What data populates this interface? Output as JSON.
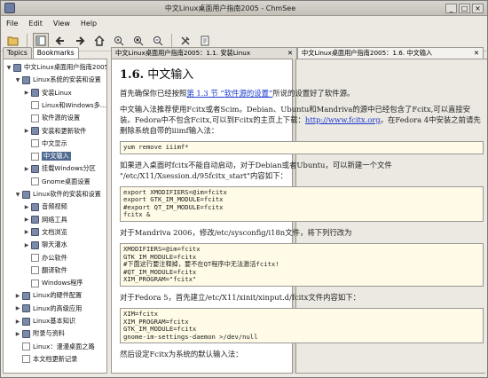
{
  "window": {
    "title": "中文Linux桌面用户指南2005 - ChmSee"
  },
  "menubar": {
    "file": "File",
    "edit": "Edit",
    "view": "View",
    "help": "Help"
  },
  "toolbar": {
    "icons": [
      "folder-open-icon",
      "sidebar-toggle-icon",
      "back-icon",
      "forward-icon",
      "home-icon",
      "zoom-in-icon",
      "zoom-reset-icon",
      "zoom-out-icon",
      "settings-icon",
      "info-icon"
    ]
  },
  "sidebar": {
    "tabs": [
      {
        "label": "Topics"
      },
      {
        "label": "Bookmarks"
      }
    ],
    "items": [
      {
        "label": "中文Linux桌面用户指南2005",
        "level": 0,
        "expander": "▼",
        "icon": "book"
      },
      {
        "label": "Linux系统的安装和设置",
        "level": 1,
        "expander": "▼",
        "icon": "book"
      },
      {
        "label": "安装Linux",
        "level": 2,
        "expander": "▶",
        "icon": "book"
      },
      {
        "label": "Linux和Windows多...",
        "level": 2,
        "expander": "",
        "icon": "page"
      },
      {
        "label": "软件源的设置",
        "level": 2,
        "expander": "",
        "icon": "page"
      },
      {
        "label": "安装和更新软件",
        "level": 2,
        "expander": "▶",
        "icon": "book"
      },
      {
        "label": "中文显示",
        "level": 2,
        "expander": "",
        "icon": "page"
      },
      {
        "label": "中文输入",
        "level": 2,
        "expander": "",
        "icon": "page",
        "selected": true
      },
      {
        "label": "挂载Windows分区",
        "level": 2,
        "expander": "▶",
        "icon": "book"
      },
      {
        "label": "Gnome桌面设置",
        "level": 2,
        "expander": "",
        "icon": "page"
      },
      {
        "label": "Linux软件的安装和设置",
        "level": 1,
        "expander": "▼",
        "icon": "book"
      },
      {
        "label": "音频视频",
        "level": 2,
        "expander": "▶",
        "icon": "book"
      },
      {
        "label": "网络工具",
        "level": 2,
        "expander": "▶",
        "icon": "book"
      },
      {
        "label": "文档浏览",
        "level": 2,
        "expander": "▶",
        "icon": "book"
      },
      {
        "label": "聊天灌水",
        "level": 2,
        "expander": "▶",
        "icon": "book"
      },
      {
        "label": "办公软件",
        "level": 2,
        "expander": "",
        "icon": "page"
      },
      {
        "label": "翻译软件",
        "level": 2,
        "expander": "",
        "icon": "page"
      },
      {
        "label": "Windows程序",
        "level": 2,
        "expander": "",
        "icon": "page"
      },
      {
        "label": "Linux的硬件配置",
        "level": 1,
        "expander": "▶",
        "icon": "book"
      },
      {
        "label": "Linux的高级应用",
        "level": 1,
        "expander": "▶",
        "icon": "book"
      },
      {
        "label": "Linux基本知识",
        "level": 1,
        "expander": "▶",
        "icon": "book"
      },
      {
        "label": "附录与资料",
        "level": 1,
        "expander": "▶",
        "icon": "book"
      },
      {
        "label": "Linux：漫漫桌面之路",
        "level": 1,
        "expander": "",
        "icon": "page"
      },
      {
        "label": "本文档更新记录",
        "level": 1,
        "expander": "",
        "icon": "page"
      }
    ]
  },
  "tabs": [
    {
      "label": "中文Linux桌面用户指南2005：1.1. 安装Linux",
      "close": "✕"
    },
    {
      "label": "中文Linux桌面用户指南2005：1.6. 中文输入",
      "close": "✕"
    }
  ],
  "page": {
    "heading_num": "1.6.",
    "heading_text": "中文输入",
    "p1_a": "首先确保你已经按照",
    "p1_link": "第 1.3 节 “软件源的设置”",
    "p1_b": "所说的设置好了软件源。",
    "p2_a": "中文输入法推荐使用Fcitx或者Scim。Debian、Ubuntu和Mandriva的源中已经包含了Fcitx,可以直接安装。Fedora中不包含Fcitx,可以到Fcitx的主页上下载：",
    "p2_link": "http://www.fcitx.org",
    "p2_b": "。在Fedora 4中安装之前请先删除系统自带的iiimf输入法：",
    "code1": "yum remove iiimf*",
    "p3": "如果进入桌面时fcitx不能自动启动，对于Debian或者Ubuntu，可以新建一个文件 \"/etc/X11/Xsession.d/95fcitx_start\"内容如下：",
    "code2": "export XMODIFIERS=@im=fcitx\nexport GTK_IM_MODULE=fcitx\n#export QT_IM_MODULE=fcitx\nfcitx &",
    "p4": "对于Mandriva 2006，修改/etc/sysconfig/i18n文件，将下列行改为",
    "code3": "XMODIFIERS=@im=fcitx\nGTK_IM_MODULE=fcitx\n#下面这行要注释掉，要不在QT程序中无法激活fcitx!\n#QT_IM_MODULE=fcitx\nXIM_PROGRAM=\"fcitx\"",
    "p5": "对于Fedora 5，首先建立/etc/X11/xinit/xinput.d/fcitx文件内容如下：",
    "code4": "XIM=fcitx\nXIM_PROGRAM=fcitx\nGTK_IM_MODULE=fcitx\ngnome-im-settings-daemon >/dev/null",
    "p6": "然后设定Fcitx为系统的默认输入法："
  }
}
